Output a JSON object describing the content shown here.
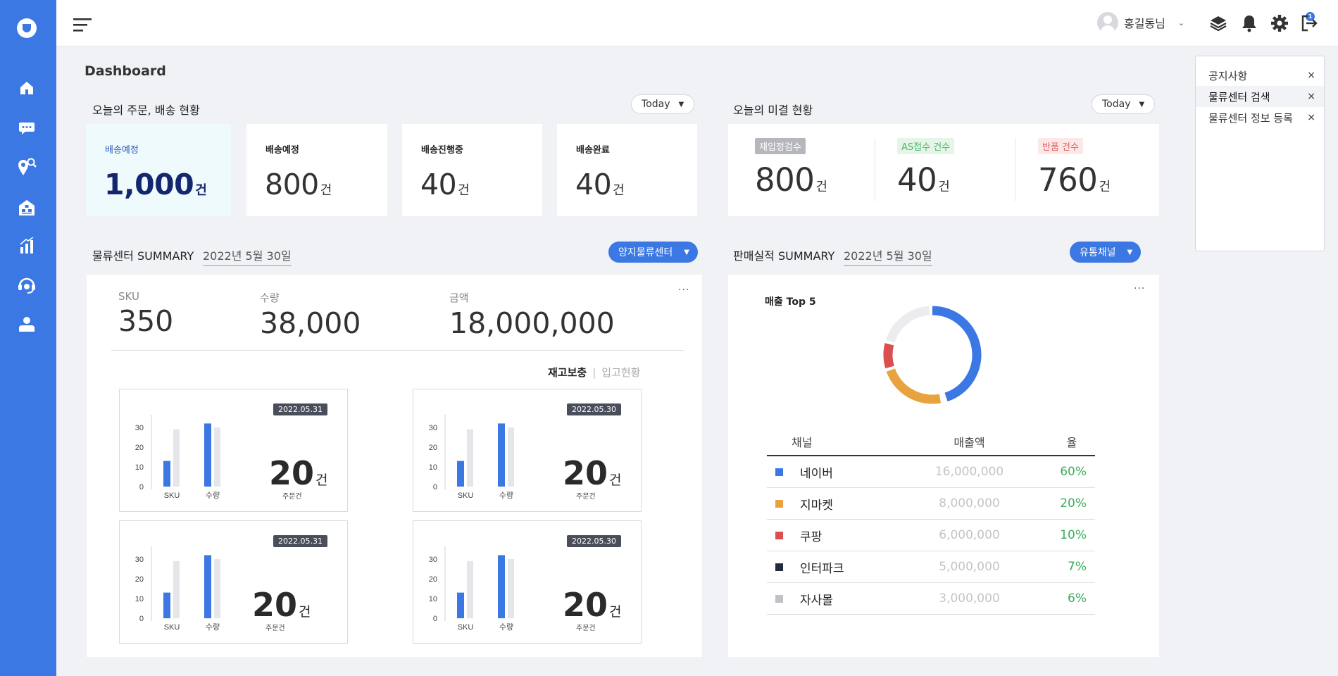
{
  "header": {
    "user_name": "홍길동님",
    "notification_count": "1"
  },
  "page": {
    "title": "Dashboard"
  },
  "orders": {
    "title": "오늘의 주문, 배송 현황",
    "period": "Today",
    "cards": [
      {
        "label": "배송예정",
        "value": "1,000",
        "unit": "건"
      },
      {
        "label": "배송예정",
        "value": "800",
        "unit": "건"
      },
      {
        "label": "배송진행중",
        "value": "40",
        "unit": "건"
      },
      {
        "label": "배송완료",
        "value": "40",
        "unit": "건"
      }
    ]
  },
  "pending": {
    "title": "오늘의 미결 현황",
    "period": "Today",
    "items": [
      {
        "label": "재입정검수",
        "value": "800",
        "unit": "건"
      },
      {
        "label": "AS접수 건수",
        "value": "40",
        "unit": "건"
      },
      {
        "label": "반품 건수",
        "value": "760",
        "unit": "건"
      }
    ]
  },
  "logistics": {
    "title": "물류센터 SUMMARY",
    "date": "2022년 5월 30일",
    "center": "양지물류센터",
    "sku_label": "SKU",
    "sku": "350",
    "qty_label": "수량",
    "qty": "38,000",
    "amount_label": "금액",
    "amount": "18,000,000",
    "tab_active": "재고보충",
    "tab_separator": "|",
    "tab_inactive": "입고현황",
    "y_ticks": [
      "30",
      "20",
      "10",
      "0"
    ],
    "bar_categories": [
      "SKU",
      "수량"
    ],
    "order_caption": "주문건",
    "mini_cards": [
      {
        "date": "2022.05.31",
        "count": "20",
        "unit": "건",
        "bars": [
          {
            "blue": 13,
            "gray": 29
          },
          {
            "blue": 32,
            "gray": 30
          }
        ]
      },
      {
        "date": "2022.05.30",
        "count": "20",
        "unit": "건",
        "bars": [
          {
            "blue": 13,
            "gray": 29
          },
          {
            "blue": 32,
            "gray": 30
          }
        ]
      },
      {
        "date": "2022.05.31",
        "count": "20",
        "unit": "건",
        "bars": [
          {
            "blue": 13,
            "gray": 29
          },
          {
            "blue": 32,
            "gray": 30
          }
        ]
      },
      {
        "date": "2022.05.30",
        "count": "20",
        "unit": "건",
        "bars": [
          {
            "blue": 13,
            "gray": 29
          },
          {
            "blue": 32,
            "gray": 30
          }
        ]
      }
    ]
  },
  "sales": {
    "title": "판매실적 SUMMARY",
    "date": "2022년 5월 30일",
    "channel_filter": "유통채널",
    "chart_title": "매출 Top 5",
    "columns": [
      "채널",
      "매출액",
      "율"
    ],
    "rows": [
      {
        "channel": "네이버",
        "amount": "16,000,000",
        "rate": "60%",
        "color": "#3b78e3"
      },
      {
        "channel": "지마켓",
        "amount": "8,000,000",
        "rate": "20%",
        "color": "#e9a33e"
      },
      {
        "channel": "쿠팡",
        "amount": "6,000,000",
        "rate": "10%",
        "color": "#dc4f4f"
      },
      {
        "channel": "인터파크",
        "amount": "5,000,000",
        "rate": "7%",
        "color": "#232a3e"
      },
      {
        "channel": "자사몰",
        "amount": "3,000,000",
        "rate": "6%",
        "color": "#bfc1c6"
      }
    ]
  },
  "notice_panel": {
    "items": [
      {
        "label": "공지사항"
      },
      {
        "label": "물류센터 검색"
      },
      {
        "label": "물류센터 정보 등록"
      }
    ],
    "close_symbol": "×"
  },
  "chart_data": [
    {
      "type": "bar",
      "categories": [
        "SKU",
        "수량"
      ],
      "ylim": [
        0,
        30
      ],
      "yticks": [
        0,
        10,
        20,
        30
      ],
      "series": [
        {
          "values": [
            13,
            32
          ]
        },
        {
          "values": [
            29,
            30
          ]
        }
      ]
    },
    {
      "type": "pie",
      "title": "매출 Top 5",
      "categories": [
        "네이버",
        "지마켓",
        "쿠팡",
        "인터파크",
        "자사몰"
      ],
      "values": [
        16000000,
        8000000,
        6000000,
        5000000,
        3000000
      ],
      "rates": [
        "60%",
        "20%",
        "10%",
        "7%",
        "6%"
      ],
      "donut_segments": [
        {
          "color": "#3b78e3",
          "start_deg": 0,
          "end_deg": 162
        },
        {
          "color": "#e9a33e",
          "start_deg": 170,
          "end_deg": 250
        },
        {
          "color": "#dc4f4f",
          "start_deg": 254,
          "end_deg": 284
        },
        {
          "color": "#ebecef",
          "start_deg": 288,
          "end_deg": 356
        }
      ]
    }
  ],
  "colors": {
    "accent": "#3b78e3",
    "sidebar": "#3b78e3",
    "highlight_card": "#eefafb",
    "pending_tags": [
      "#b5b7bc",
      "#e5f5e8",
      "#fde8e8"
    ],
    "rate_text": "#3aad5a"
  },
  "icons": {
    "sidebar": [
      "logo-icon",
      "home-icon",
      "chat-icon",
      "location-search-icon",
      "warehouse-icon",
      "chart-icon",
      "support-icon",
      "user-icon"
    ],
    "topbar": [
      "menu-icon",
      "layers-icon",
      "bell-icon",
      "gear-icon",
      "logout-icon"
    ]
  }
}
